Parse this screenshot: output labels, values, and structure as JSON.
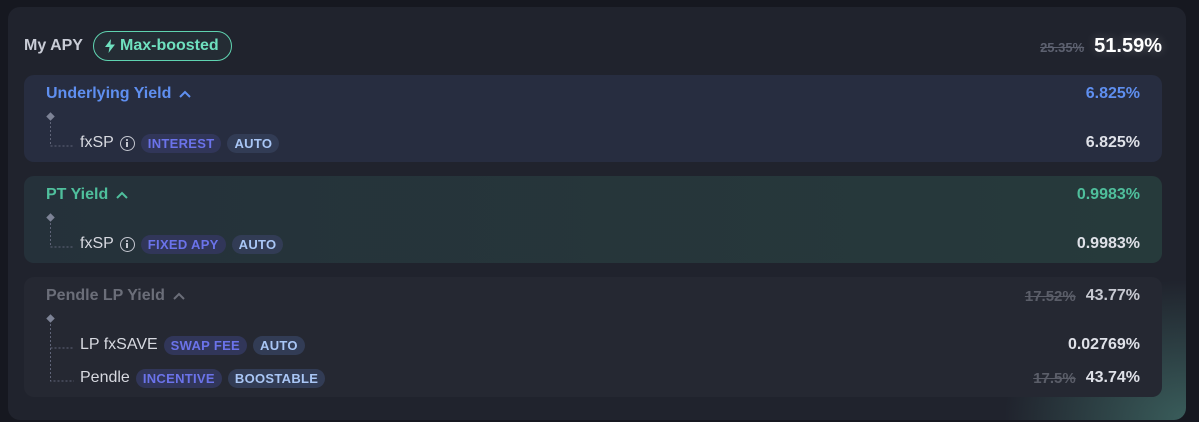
{
  "header": {
    "title": "My APY",
    "badge": "Max-boosted",
    "old_total": "25.35%",
    "total": "51.59%"
  },
  "sections": [
    {
      "title": "Underlying Yield",
      "value": "6.825%",
      "rows": [
        {
          "label": "fxSP",
          "tags": [
            "INTEREST",
            "AUTO"
          ],
          "value": "6.825%"
        }
      ]
    },
    {
      "title": "PT Yield",
      "value": "0.9983%",
      "rows": [
        {
          "label": "fxSP",
          "tags": [
            "FIXED APY",
            "AUTO"
          ],
          "value": "0.9983%"
        }
      ]
    },
    {
      "title": "Pendle LP Yield",
      "old_value": "17.52%",
      "value": "43.77%",
      "rows": [
        {
          "label": "LP fxSAVE",
          "tags": [
            "SWAP FEE",
            "AUTO"
          ],
          "value": "0.02769%"
        },
        {
          "label": "Pendle",
          "tags": [
            "INCENTIVE",
            "BOOSTABLE"
          ],
          "old_value": "17.5%",
          "value": "43.74%"
        }
      ]
    }
  ],
  "colors": {
    "underlying": "#5f8ff0",
    "pt": "#4fbf9c",
    "badge": "#5fd3b0",
    "tag_purple": "#6b73ea",
    "tag_blue": "#a9c6f5"
  },
  "icons": [
    "bolt-icon",
    "chevron-up-icon",
    "info-icon"
  ]
}
